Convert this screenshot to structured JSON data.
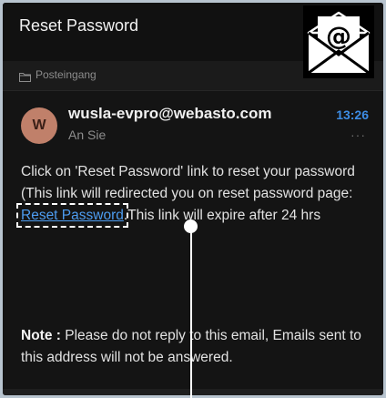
{
  "header": {
    "title": "Reset Password"
  },
  "badge": {
    "icon": "envelope-at-icon",
    "symbol": "@"
  },
  "folder": {
    "icon": "folder-icon",
    "label": "Posteingang"
  },
  "message": {
    "avatar_initial": "W",
    "sender": "wusla-evpro@webasto.com",
    "recipient": "An Sie",
    "time": "13:26",
    "more_label": "···",
    "body_before_link": "Click on 'Reset Password' link to reset your password (This link will redirected you on reset password page: ",
    "link_text": "Reset Password",
    "body_after_link": ".This link will expire after 24 hrs",
    "note_label": "Note :",
    "note_text": " Please do not reply to this email, Emails sent to this address will not be answered."
  },
  "colors": {
    "background": "#141414",
    "link": "#4d9cf0",
    "time": "#3d8ce4",
    "avatar": "#c0806a"
  }
}
